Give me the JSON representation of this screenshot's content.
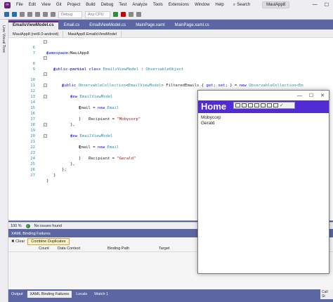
{
  "menu": [
    "File",
    "Edit",
    "View",
    "Git",
    "Project",
    "Build",
    "Debug",
    "Test",
    "Analyze",
    "Tools",
    "Extensions",
    "Window",
    "Help"
  ],
  "search_label": "Search",
  "app_name": "MauiApp8",
  "toolbar": {
    "config": "Debug",
    "platform": "Any CPU"
  },
  "side_tool": "Live Visual Tree",
  "tabs": [
    "EmailsViewModel.cs",
    "Email.cs",
    "EmailViewModel.cs",
    "MainPage.xaml",
    "MainPage.xaml.cs"
  ],
  "nav": {
    "project": "MauiApp8 (net6.0-android)",
    "type": "MauiApp8.EmailsViewModel"
  },
  "code": {
    "n6": "6",
    "n7": "7",
    "n8": "8",
    "n9": "9",
    "n10": "10",
    "n11": "11",
    "n12": "12",
    "n13": "13",
    "n14": "14",
    "n15": "15",
    "n16": "16",
    "n17": "17",
    "n18": "18",
    "n19": "19",
    "n20": "20",
    "n21": "21",
    "n22": "22",
    "n23": "23",
    "n24": "24",
    "n25": "25",
    "n26": "26",
    "n27": "27",
    "kw_namespace": "namespace",
    "ns_name": " MauiApp8",
    "brace_open": "{",
    "brace_close": "}",
    "refs1": "1 reference",
    "kw_public_partial_class": "public partial class ",
    "class_name": "EmailsViewModel",
    "colon": " : ",
    "base_class": "ObservableObject",
    "refs0": "0 references",
    "kw_public": "public ",
    "coll_type": "ObservableCollection",
    "coll_open": "<",
    "coll_inner": "EmailViewModel",
    "coll_close": ">",
    "prop_decl": " FilteredEmails { ",
    "kw_get": "get",
    "semi1": "; ",
    "kw_set": "set",
    "semi2": "; } = ",
    "kw_new": "new ",
    "coll_tail": "ObservableCollection<Em",
    "kw_new_evm": "new ",
    "evm": "EmailViewModel",
    "email_assign": "Email = ",
    "email_type": "Email",
    "recipient_assign": "Recipient = ",
    "recipient1": "\"Mobycorp\"",
    "recipient2": "\"Gerald\"",
    "brace_close_comma": "},",
    "brace_close_semi": "};"
  },
  "status": {
    "zoom": "100 %",
    "issues": "No issues found"
  },
  "bottom_panel": {
    "title": "XAML Binding Failures",
    "clear": "Clear",
    "combine": "Combine Duplicates",
    "columns": [
      "Count",
      "Data Context",
      "Binding Path",
      "Target"
    ]
  },
  "bottom_tabs": [
    "Output",
    "XAML Binding Failures",
    "Locals",
    "Watch 1"
  ],
  "call_stack": "Call St",
  "maui": {
    "header": "Home",
    "items": [
      "Mobycorp",
      "Gerald"
    ]
  }
}
